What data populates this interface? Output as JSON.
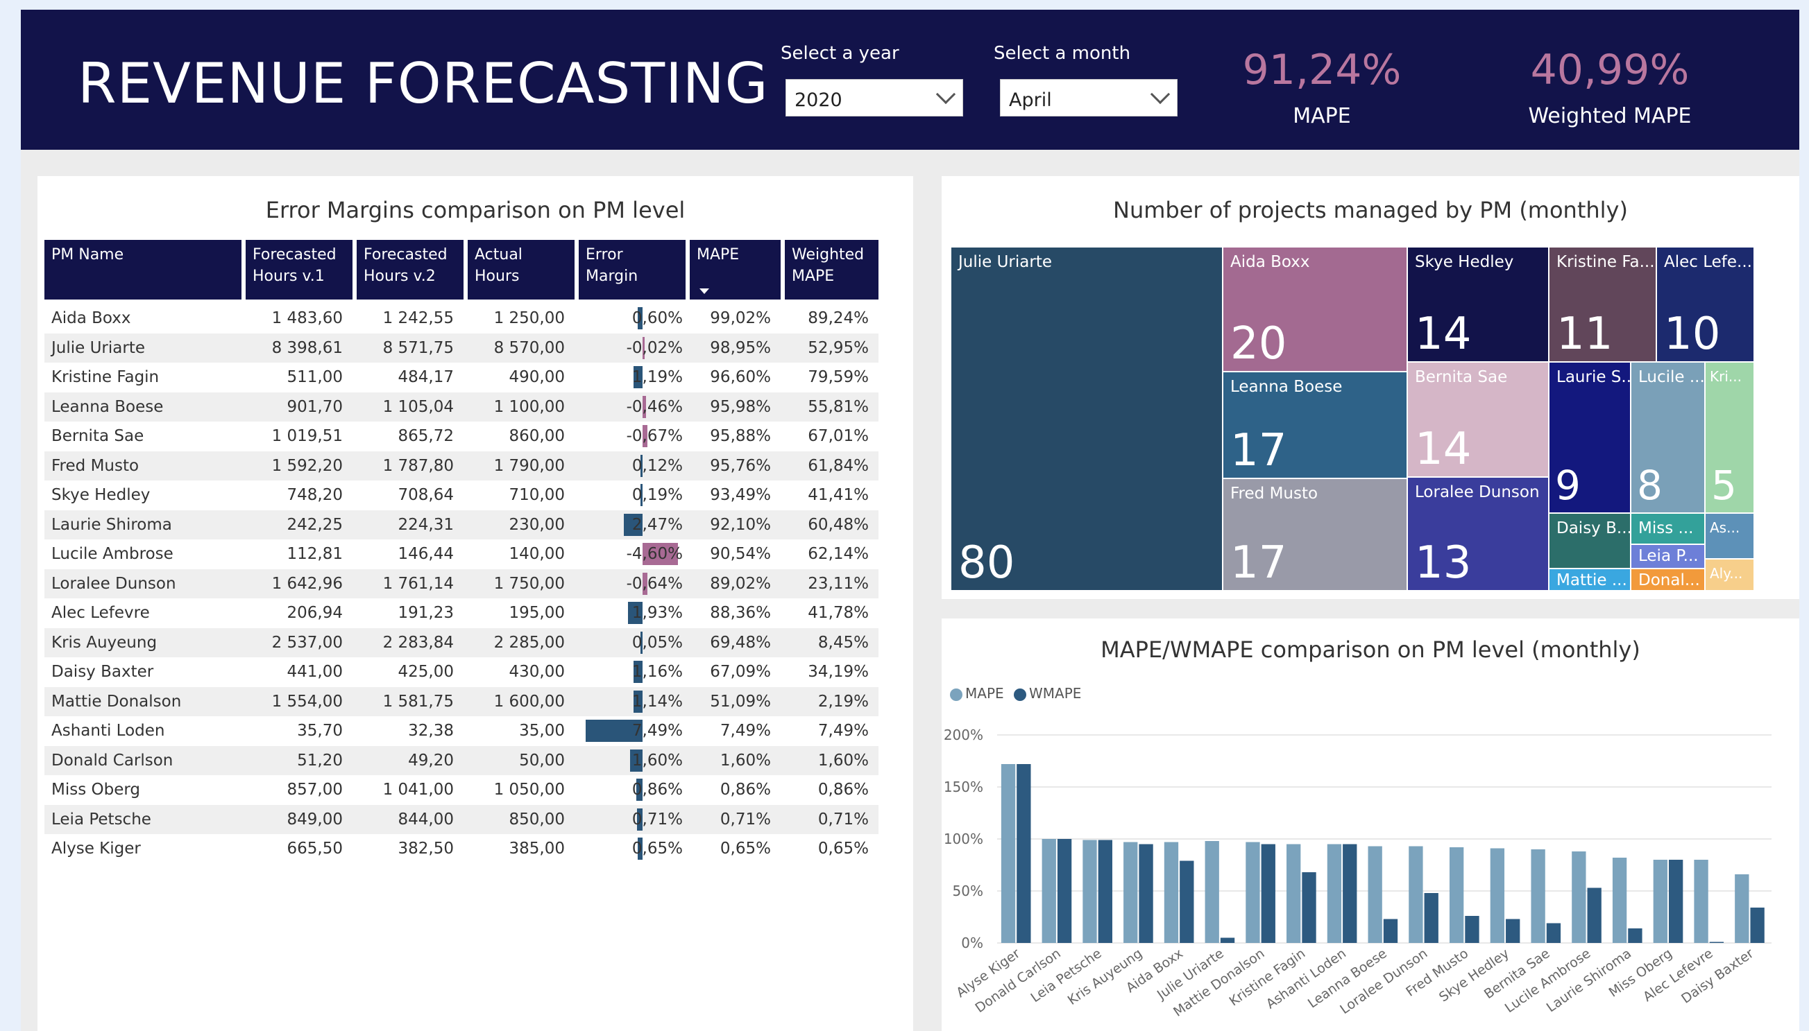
{
  "header": {
    "title": "REVENUE FORECASTING",
    "year_label": "Select a year",
    "year_value": "2020",
    "month_label": "Select a month",
    "month_value": "April",
    "kpi_mape_value": "91,24%",
    "kpi_mape_label": "MAPE",
    "kpi_wmape_value": "40,99%",
    "kpi_wmape_label": "Weighted MAPE"
  },
  "table": {
    "title": "Error Margins comparison on PM level",
    "columns": [
      "PM Name",
      "Forecasted Hours v.1",
      "Forecasted Hours v.2",
      "Actual Hours",
      "Error Margin",
      "MAPE",
      "Weighted MAPE"
    ],
    "rows": [
      {
        "name": "Aida Boxx",
        "f1": "1 483,60",
        "f2": "1 242,55",
        "actual": "1 250,00",
        "err": "0,60%",
        "err_value": 0.6,
        "mape": "99,02%",
        "wmape": "89,24%"
      },
      {
        "name": "Julie Uriarte",
        "f1": "8 398,61",
        "f2": "8 571,75",
        "actual": "8 570,00",
        "err": "-0,02%",
        "err_value": -0.02,
        "mape": "98,95%",
        "wmape": "52,95%"
      },
      {
        "name": "Kristine Fagin",
        "f1": "511,00",
        "f2": "484,17",
        "actual": "490,00",
        "err": "1,19%",
        "err_value": 1.19,
        "mape": "96,60%",
        "wmape": "79,59%"
      },
      {
        "name": "Leanna Boese",
        "f1": "901,70",
        "f2": "1 105,04",
        "actual": "1 100,00",
        "err": "-0,46%",
        "err_value": -0.46,
        "mape": "95,98%",
        "wmape": "55,81%"
      },
      {
        "name": "Bernita Sae",
        "f1": "1 019,51",
        "f2": "865,72",
        "actual": "860,00",
        "err": "-0,67%",
        "err_value": -0.67,
        "mape": "95,88%",
        "wmape": "67,01%"
      },
      {
        "name": "Fred Musto",
        "f1": "1 592,20",
        "f2": "1 787,80",
        "actual": "1 790,00",
        "err": "0,12%",
        "err_value": 0.12,
        "mape": "95,76%",
        "wmape": "61,84%"
      },
      {
        "name": "Skye Hedley",
        "f1": "748,20",
        "f2": "708,64",
        "actual": "710,00",
        "err": "0,19%",
        "err_value": 0.19,
        "mape": "93,49%",
        "wmape": "41,41%"
      },
      {
        "name": "Laurie Shiroma",
        "f1": "242,25",
        "f2": "224,31",
        "actual": "230,00",
        "err": "2,47%",
        "err_value": 2.47,
        "mape": "92,10%",
        "wmape": "60,48%"
      },
      {
        "name": "Lucile Ambrose",
        "f1": "112,81",
        "f2": "146,44",
        "actual": "140,00",
        "err": "-4,60%",
        "err_value": -4.6,
        "mape": "90,54%",
        "wmape": "62,14%"
      },
      {
        "name": "Loralee Dunson",
        "f1": "1 642,96",
        "f2": "1 761,14",
        "actual": "1 750,00",
        "err": "-0,64%",
        "err_value": -0.64,
        "mape": "89,02%",
        "wmape": "23,11%"
      },
      {
        "name": "Alec Lefevre",
        "f1": "206,94",
        "f2": "191,23",
        "actual": "195,00",
        "err": "1,93%",
        "err_value": 1.93,
        "mape": "88,36%",
        "wmape": "41,78%"
      },
      {
        "name": "Kris Auyeung",
        "f1": "2 537,00",
        "f2": "2 283,84",
        "actual": "2 285,00",
        "err": "0,05%",
        "err_value": 0.05,
        "mape": "69,48%",
        "wmape": "8,45%"
      },
      {
        "name": "Daisy Baxter",
        "f1": "441,00",
        "f2": "425,00",
        "actual": "430,00",
        "err": "1,16%",
        "err_value": 1.16,
        "mape": "67,09%",
        "wmape": "34,19%"
      },
      {
        "name": "Mattie Donalson",
        "f1": "1 554,00",
        "f2": "1 581,75",
        "actual": "1 600,00",
        "err": "1,14%",
        "err_value": 1.14,
        "mape": "51,09%",
        "wmape": "2,19%"
      },
      {
        "name": "Ashanti Loden",
        "f1": "35,70",
        "f2": "32,38",
        "actual": "35,00",
        "err": "7,49%",
        "err_value": 7.49,
        "mape": "7,49%",
        "wmape": "7,49%"
      },
      {
        "name": "Donald Carlson",
        "f1": "51,20",
        "f2": "49,20",
        "actual": "50,00",
        "err": "1,60%",
        "err_value": 1.6,
        "mape": "1,60%",
        "wmape": "1,60%"
      },
      {
        "name": "Miss Oberg",
        "f1": "857,00",
        "f2": "1 041,00",
        "actual": "1 050,00",
        "err": "0,86%",
        "err_value": 0.86,
        "mape": "0,86%",
        "wmape": "0,86%"
      },
      {
        "name": "Leia Petsche",
        "f1": "849,00",
        "f2": "844,00",
        "actual": "850,00",
        "err": "0,71%",
        "err_value": 0.71,
        "mape": "0,71%",
        "wmape": "0,71%"
      },
      {
        "name": "Alyse Kiger",
        "f1": "665,50",
        "f2": "382,50",
        "actual": "385,00",
        "err": "0,65%",
        "err_value": 0.65,
        "mape": "0,65%",
        "wmape": "0,65%"
      }
    ]
  },
  "treemap": {
    "title": "Number of projects managed by PM (monthly)",
    "tiles": [
      {
        "label": "Julie Uriarte",
        "value": "80",
        "color": "#274a66"
      },
      {
        "label": "Aida Boxx",
        "value": "20",
        "color": "#a36a91"
      },
      {
        "label": "Leanna Boese",
        "value": "17",
        "color": "#2e6288"
      },
      {
        "label": "Fred Musto",
        "value": "17",
        "color": "#999aa8"
      },
      {
        "label": "Skye Hedley",
        "value": "14",
        "color": "#12134a"
      },
      {
        "label": "Bernita Sae",
        "value": "14",
        "color": "#d5b6c7"
      },
      {
        "label": "Loralee Dunson",
        "value": "13",
        "color": "#3a3d9c"
      },
      {
        "label": "Kristine Fa...",
        "value": "11",
        "color": "#61465a"
      },
      {
        "label": "Alec Lefe...",
        "value": "10",
        "color": "#1c2a6e"
      },
      {
        "label": "Laurie S...",
        "value": "9",
        "color": "#13187e"
      },
      {
        "label": "Lucile ...",
        "value": "8",
        "color": "#7aa0b8"
      },
      {
        "label": "Kri...",
        "value": "5",
        "color": "#9fd6a9"
      },
      {
        "label": "Daisy B...",
        "value": "",
        "color": "#2c6e6a"
      },
      {
        "label": "Miss ...",
        "value": "",
        "color": "#33a19a"
      },
      {
        "label": "As...",
        "value": "",
        "color": "#5d91b8"
      },
      {
        "label": "Leia P...",
        "value": "",
        "color": "#6d7fd8"
      },
      {
        "label": "Mattie ...",
        "value": "",
        "color": "#3aa7e0"
      },
      {
        "label": "Donal...",
        "value": "",
        "color": "#f29a3b"
      },
      {
        "label": "Aly...",
        "value": "",
        "color": "#f7cf8b"
      }
    ]
  },
  "chart_data": {
    "type": "bar",
    "title": "MAPE/WMAPE comparison on PM level (monthly)",
    "categories": [
      "Alyse Kiger",
      "Donald Carlson",
      "Leia Petsche",
      "Kris Auyeung",
      "Aida Boxx",
      "Julie Uriarte",
      "Mattie Donalson",
      "Kristine Fagin",
      "Ashanti Loden",
      "Leanna Boese",
      "Loralee Dunson",
      "Fred Musto",
      "Skye Hedley",
      "Bernita Sae",
      "Lucile Ambrose",
      "Laurie Shiroma",
      "Miss Oberg",
      "Alec Lefevre",
      "Daisy Baxter"
    ],
    "series": [
      {
        "name": "MAPE",
        "color": "#7ba3bd",
        "values": [
          172,
          100,
          99,
          97,
          97,
          98,
          97,
          95,
          95,
          93,
          93,
          92,
          91,
          90,
          88,
          82,
          80,
          80,
          66
        ]
      },
      {
        "name": "WMAPE",
        "color": "#2d5a80",
        "values": [
          172,
          100,
          99,
          95,
          79,
          5,
          95,
          68,
          95,
          23,
          48,
          26,
          23,
          19,
          53,
          14,
          80,
          1,
          34
        ]
      }
    ],
    "yticks": [
      "200%",
      "150%",
      "100%",
      "50%",
      "0%"
    ],
    "ylim": [
      0,
      200
    ],
    "legend": "top-left",
    "grid": true
  },
  "colors": {
    "header_bg": "#12134a",
    "kpi": "#b9779f",
    "err_pos": "#2a5579",
    "err_neg": "#a86a94"
  }
}
